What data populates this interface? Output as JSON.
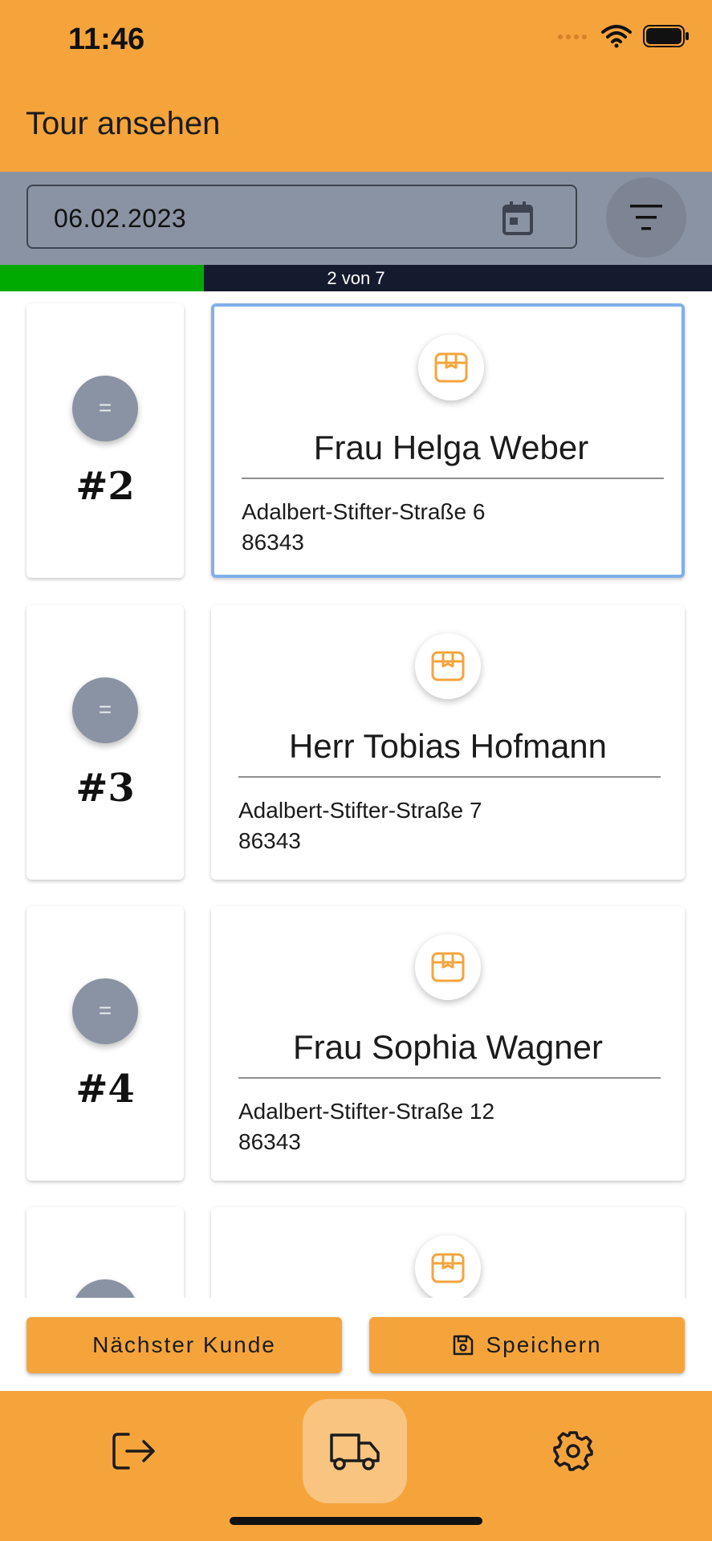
{
  "status_bar": {
    "time": "11:46"
  },
  "header": {
    "title": "Tour ansehen"
  },
  "toolbar": {
    "date_value": "06.02.2023"
  },
  "progress": {
    "label": "2 von 7",
    "current": 2,
    "total": 7,
    "fill_fraction": 0.286
  },
  "stops": [
    {
      "number": "#2",
      "handle": "=",
      "name": "Frau Helga Weber",
      "street": "Adalbert-Stifter-Straße 6",
      "zip": "86343",
      "selected": true
    },
    {
      "number": "#3",
      "handle": "=",
      "name": "Herr Tobias Hofmann",
      "street": "Adalbert-Stifter-Straße 7",
      "zip": "86343",
      "selected": false
    },
    {
      "number": "#4",
      "handle": "=",
      "name": "Frau Sophia Wagner",
      "street": "Adalbert-Stifter-Straße 12",
      "zip": "86343",
      "selected": false
    },
    {
      "number": "",
      "handle": "",
      "name": "",
      "street": "",
      "zip": "",
      "selected": false
    }
  ],
  "actions": {
    "next_label": "Nächster Kunde",
    "save_label": "Speichern"
  },
  "nav": {
    "items": [
      "logout-icon",
      "truck-icon",
      "gear-icon"
    ],
    "active": "truck-icon"
  },
  "colors": {
    "accent": "#f5a43c",
    "toolbar": "#8a93a3",
    "progress_done": "#00aa00",
    "progress_track": "#141b2e",
    "selection": "#7fb0ea"
  }
}
